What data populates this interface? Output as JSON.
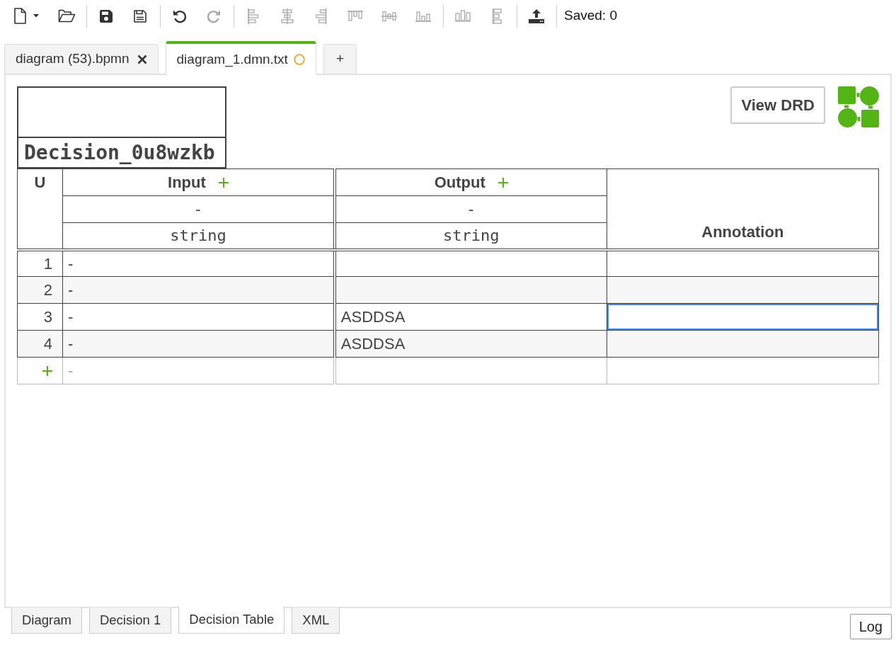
{
  "toolbar": {
    "groups": [
      {
        "buttons": [
          {
            "disabled": false
          },
          {
            "disabled": false
          }
        ]
      },
      {
        "buttons": [
          {
            "disabled": false
          },
          {
            "disabled": false
          }
        ]
      },
      {
        "buttons": [
          {
            "disabled": false
          },
          {
            "disabled": true
          }
        ]
      },
      {
        "buttons": [
          {
            "disabled": true
          },
          {
            "disabled": true
          },
          {
            "disabled": true
          },
          {
            "disabled": true
          },
          {
            "disabled": true
          },
          {
            "disabled": true
          }
        ]
      },
      {
        "buttons": [
          {
            "disabled": true
          },
          {
            "disabled": true
          }
        ]
      },
      {
        "buttons": [
          {
            "disabled": false
          }
        ]
      }
    ],
    "status": "Saved: 0"
  },
  "file_tabs": [
    {
      "label": "diagram (53).bpmn",
      "selected": false,
      "modified": false
    },
    {
      "label": "diagram_1.dmn.txt",
      "selected": true,
      "modified": true
    }
  ],
  "new_tab": "+",
  "decision": {
    "name": "Decision_0u8wzkb"
  },
  "view_drd": "View DRD",
  "table": {
    "hit_policy": "U",
    "inputs": [
      {
        "label": "Input",
        "expression": "-",
        "type": "string"
      }
    ],
    "outputs": [
      {
        "label": "Output",
        "expression": "-",
        "type": "string"
      }
    ],
    "annotation_label": "Annotation",
    "rows": [
      {
        "number": "1",
        "cells": [
          {
            "text": "-",
            "selected": false
          },
          {
            "selected": false
          },
          {
            "selected": false
          }
        ]
      },
      {
        "number": "2",
        "cells": [
          {
            "text": "-",
            "selected": false
          },
          {
            "selected": false
          },
          {
            "selected": false
          }
        ]
      },
      {
        "number": "3",
        "cells": [
          {
            "text": "-",
            "selected": false
          },
          {
            "text": "ASDDSA",
            "selected": false
          },
          {
            "selected": true
          }
        ]
      },
      {
        "number": "4",
        "cells": [
          {
            "text": "-",
            "selected": false
          },
          {
            "text": "ASDDSA",
            "selected": false
          },
          {
            "selected": false
          }
        ]
      }
    ],
    "new_rule": {
      "placeholder": "-"
    }
  },
  "view_tabs": [
    {
      "label": "Diagram",
      "selected": false
    },
    {
      "label": "Decision 1",
      "selected": false
    },
    {
      "label": "Decision Table",
      "selected": true
    },
    {
      "label": "XML",
      "selected": false
    }
  ],
  "log_button": "Log"
}
